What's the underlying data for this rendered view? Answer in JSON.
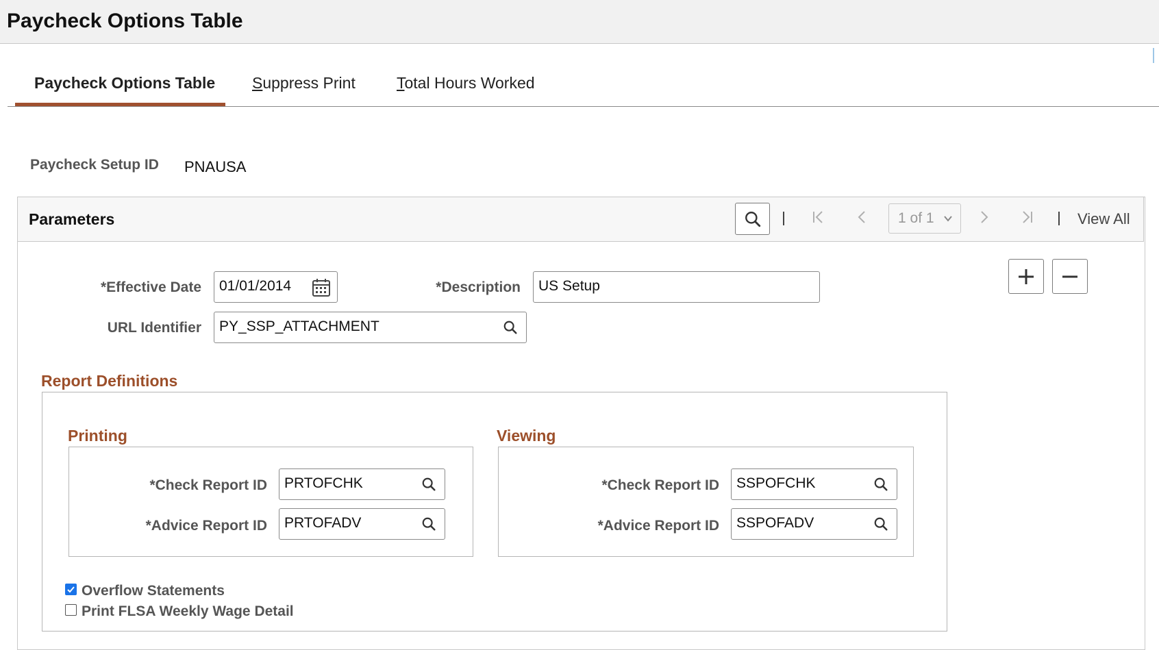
{
  "page": {
    "title": "Paycheck Options Table"
  },
  "tabs": [
    {
      "label": "Paycheck Options Table",
      "active": true
    },
    {
      "label": "Suppress Print",
      "access_key": "S"
    },
    {
      "label": "Total Hours Worked",
      "access_key": "T"
    }
  ],
  "setup": {
    "label": "Paycheck Setup ID",
    "value": "PNAUSA"
  },
  "parameters": {
    "title": "Parameters",
    "pager": {
      "position": "1 of 1",
      "view_all": "View All"
    }
  },
  "form": {
    "effective_date": {
      "label": "*Effective Date",
      "value": "01/01/2014"
    },
    "description": {
      "label": "*Description",
      "value": "US Setup"
    },
    "url_identifier": {
      "label": "URL Identifier",
      "value": "PY_SSP_ATTACHMENT"
    }
  },
  "report_definitions": {
    "title": "Report Definitions",
    "printing": {
      "title": "Printing",
      "check_label": "*Check Report ID",
      "check_value": "PRTOFCHK",
      "advice_label": "*Advice Report ID",
      "advice_value": "PRTOFADV"
    },
    "viewing": {
      "title": "Viewing",
      "check_label": "*Check Report ID",
      "check_value": "SSPOFCHK",
      "advice_label": "*Advice Report ID",
      "advice_value": "SSPOFADV"
    },
    "overflow": {
      "label": "Overflow Statements",
      "checked": true
    },
    "flsa": {
      "label": "Print FLSA Weekly Wage Detail",
      "checked": false
    }
  },
  "colors": {
    "accent": "#a0502f",
    "section": "#9c4f2a",
    "checkbox": "#1a73e8"
  },
  "icons": [
    "search-icon",
    "calendar-icon",
    "first-icon",
    "previous-icon",
    "next-icon",
    "last-icon",
    "chevron-down-icon",
    "add-icon",
    "remove-icon"
  ]
}
